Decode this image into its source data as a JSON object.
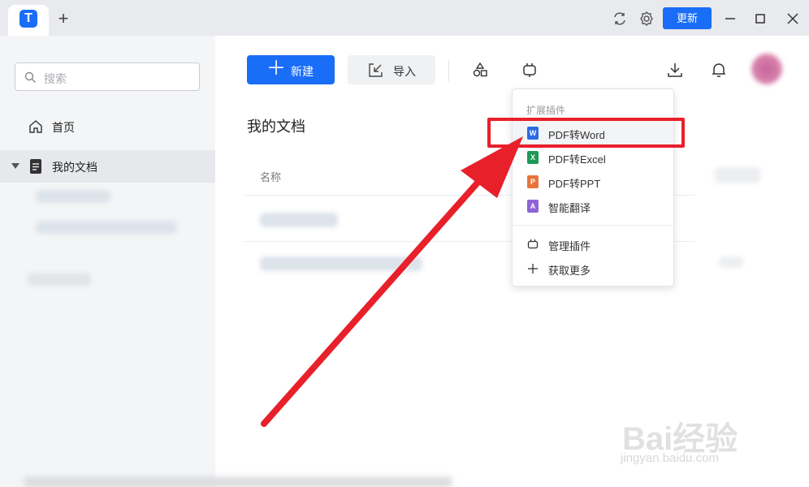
{
  "titlebar": {
    "new_tab_label": "+",
    "update_label": "更新",
    "icons": [
      "app-logo",
      "sync-icon",
      "settings-icon",
      "minimize-icon",
      "maximize-icon",
      "close-icon"
    ]
  },
  "sidebar": {
    "search": {
      "placeholder": "搜索"
    },
    "items": [
      {
        "label": "首页",
        "icon": "home-icon"
      },
      {
        "label": "我的文档",
        "icon": "document-icon"
      }
    ]
  },
  "toolbar": {
    "new_label": "新建",
    "import_label": "导入",
    "icons": [
      "shapes-icon",
      "plugin-icon",
      "download-icon",
      "bell-icon"
    ]
  },
  "main": {
    "title": "我的文档",
    "column_name": "名称"
  },
  "dropdown": {
    "header": "扩展插件",
    "items": [
      {
        "label": "PDF转Word",
        "icon": "word-icon",
        "color": "#2b6ce4",
        "glyph": "W"
      },
      {
        "label": "PDF转Excel",
        "icon": "excel-icon",
        "color": "#1e9a55",
        "glyph": "X"
      },
      {
        "label": "PDF转PPT",
        "icon": "ppt-icon",
        "color": "#e8743b",
        "glyph": "P"
      },
      {
        "label": "智能翻译",
        "icon": "translate-icon",
        "color": "#8e63d8",
        "glyph": "A"
      }
    ],
    "footer_items": [
      {
        "label": "管理插件",
        "icon": "plugin-icon"
      },
      {
        "label": "获取更多",
        "icon": "plus-icon"
      }
    ]
  },
  "annotation": {
    "color": "#e8202a"
  },
  "watermark": {
    "main": "Bai经验",
    "sub": "jingyan.baidu.com"
  }
}
